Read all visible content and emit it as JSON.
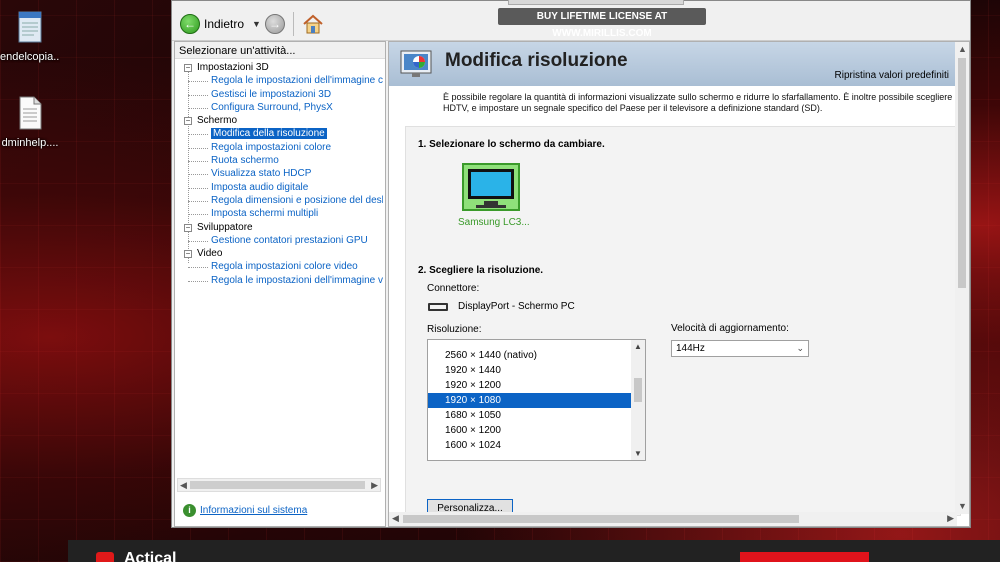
{
  "desktop": {
    "icons": [
      {
        "label": "endelcopia..."
      },
      {
        "label": "dminhelp...."
      }
    ]
  },
  "banner": {
    "text": "BUY LIFETIME LICENSE AT WWW.MIRILLIS.COM"
  },
  "toolbar": {
    "back_label": "Indietro"
  },
  "left_pane": {
    "header": "Selezionare un'attività...",
    "categories": [
      {
        "label": "Impostazioni 3D",
        "items": [
          "Regola le impostazioni dell'immagine con an",
          "Gestisci le impostazioni 3D",
          "Configura Surround, PhysX"
        ]
      },
      {
        "label": "Schermo",
        "items": [
          "Modifica della risoluzione",
          "Regola impostazioni colore",
          "Ruota schermo",
          "Visualizza stato HDCP",
          "Imposta audio digitale",
          "Regola dimensioni e posizione del desktop",
          "Imposta schermi multipli"
        ]
      },
      {
        "label": "Sviluppatore",
        "items": [
          "Gestione contatori prestazioni GPU"
        ]
      },
      {
        "label": "Video",
        "items": [
          "Regola impostazioni colore video",
          "Regola le impostazioni dell'immagine video"
        ]
      }
    ],
    "selected_item": "Modifica della risoluzione",
    "system_info_link": "Informazioni sul sistema"
  },
  "main": {
    "title": "Modifica risoluzione",
    "restore_defaults": "Ripristina valori predefiniti",
    "description_line1": "È possibile regolare la quantità di informazioni visualizzate sullo schermo e ridurre lo sfarfallamento. È inoltre possibile scegliere il form",
    "description_line2": "HDTV, e impostare un segnale specifico del Paese per il televisore a definizione standard (SD).",
    "section1_title": "1. Selezionare lo schermo da cambiare.",
    "display_name": "Samsung LC3...",
    "section2_title": "2. Scegliere la risoluzione.",
    "connector_label": "Connettore:",
    "connector_value": "DisplayPort - Schermo PC",
    "resolution_label": "Risoluzione:",
    "resolutions": [
      "2560 × 1440 (nativo)",
      "1920 × 1440",
      "1920 × 1200",
      "1920 × 1080",
      "1680 × 1050",
      "1600 × 1200",
      "1600 × 1024"
    ],
    "selected_resolution": "1920 × 1080",
    "refresh_label": "Velocità di aggiornamento:",
    "refresh_value": "144Hz",
    "customize_button": "Personalizza..."
  },
  "taskbar": {
    "app_text": "Actical"
  },
  "colors": {
    "accent": "#0b63c5",
    "link": "#0b63c5",
    "header": "#a9bed4",
    "green": "#3a9a2a"
  }
}
